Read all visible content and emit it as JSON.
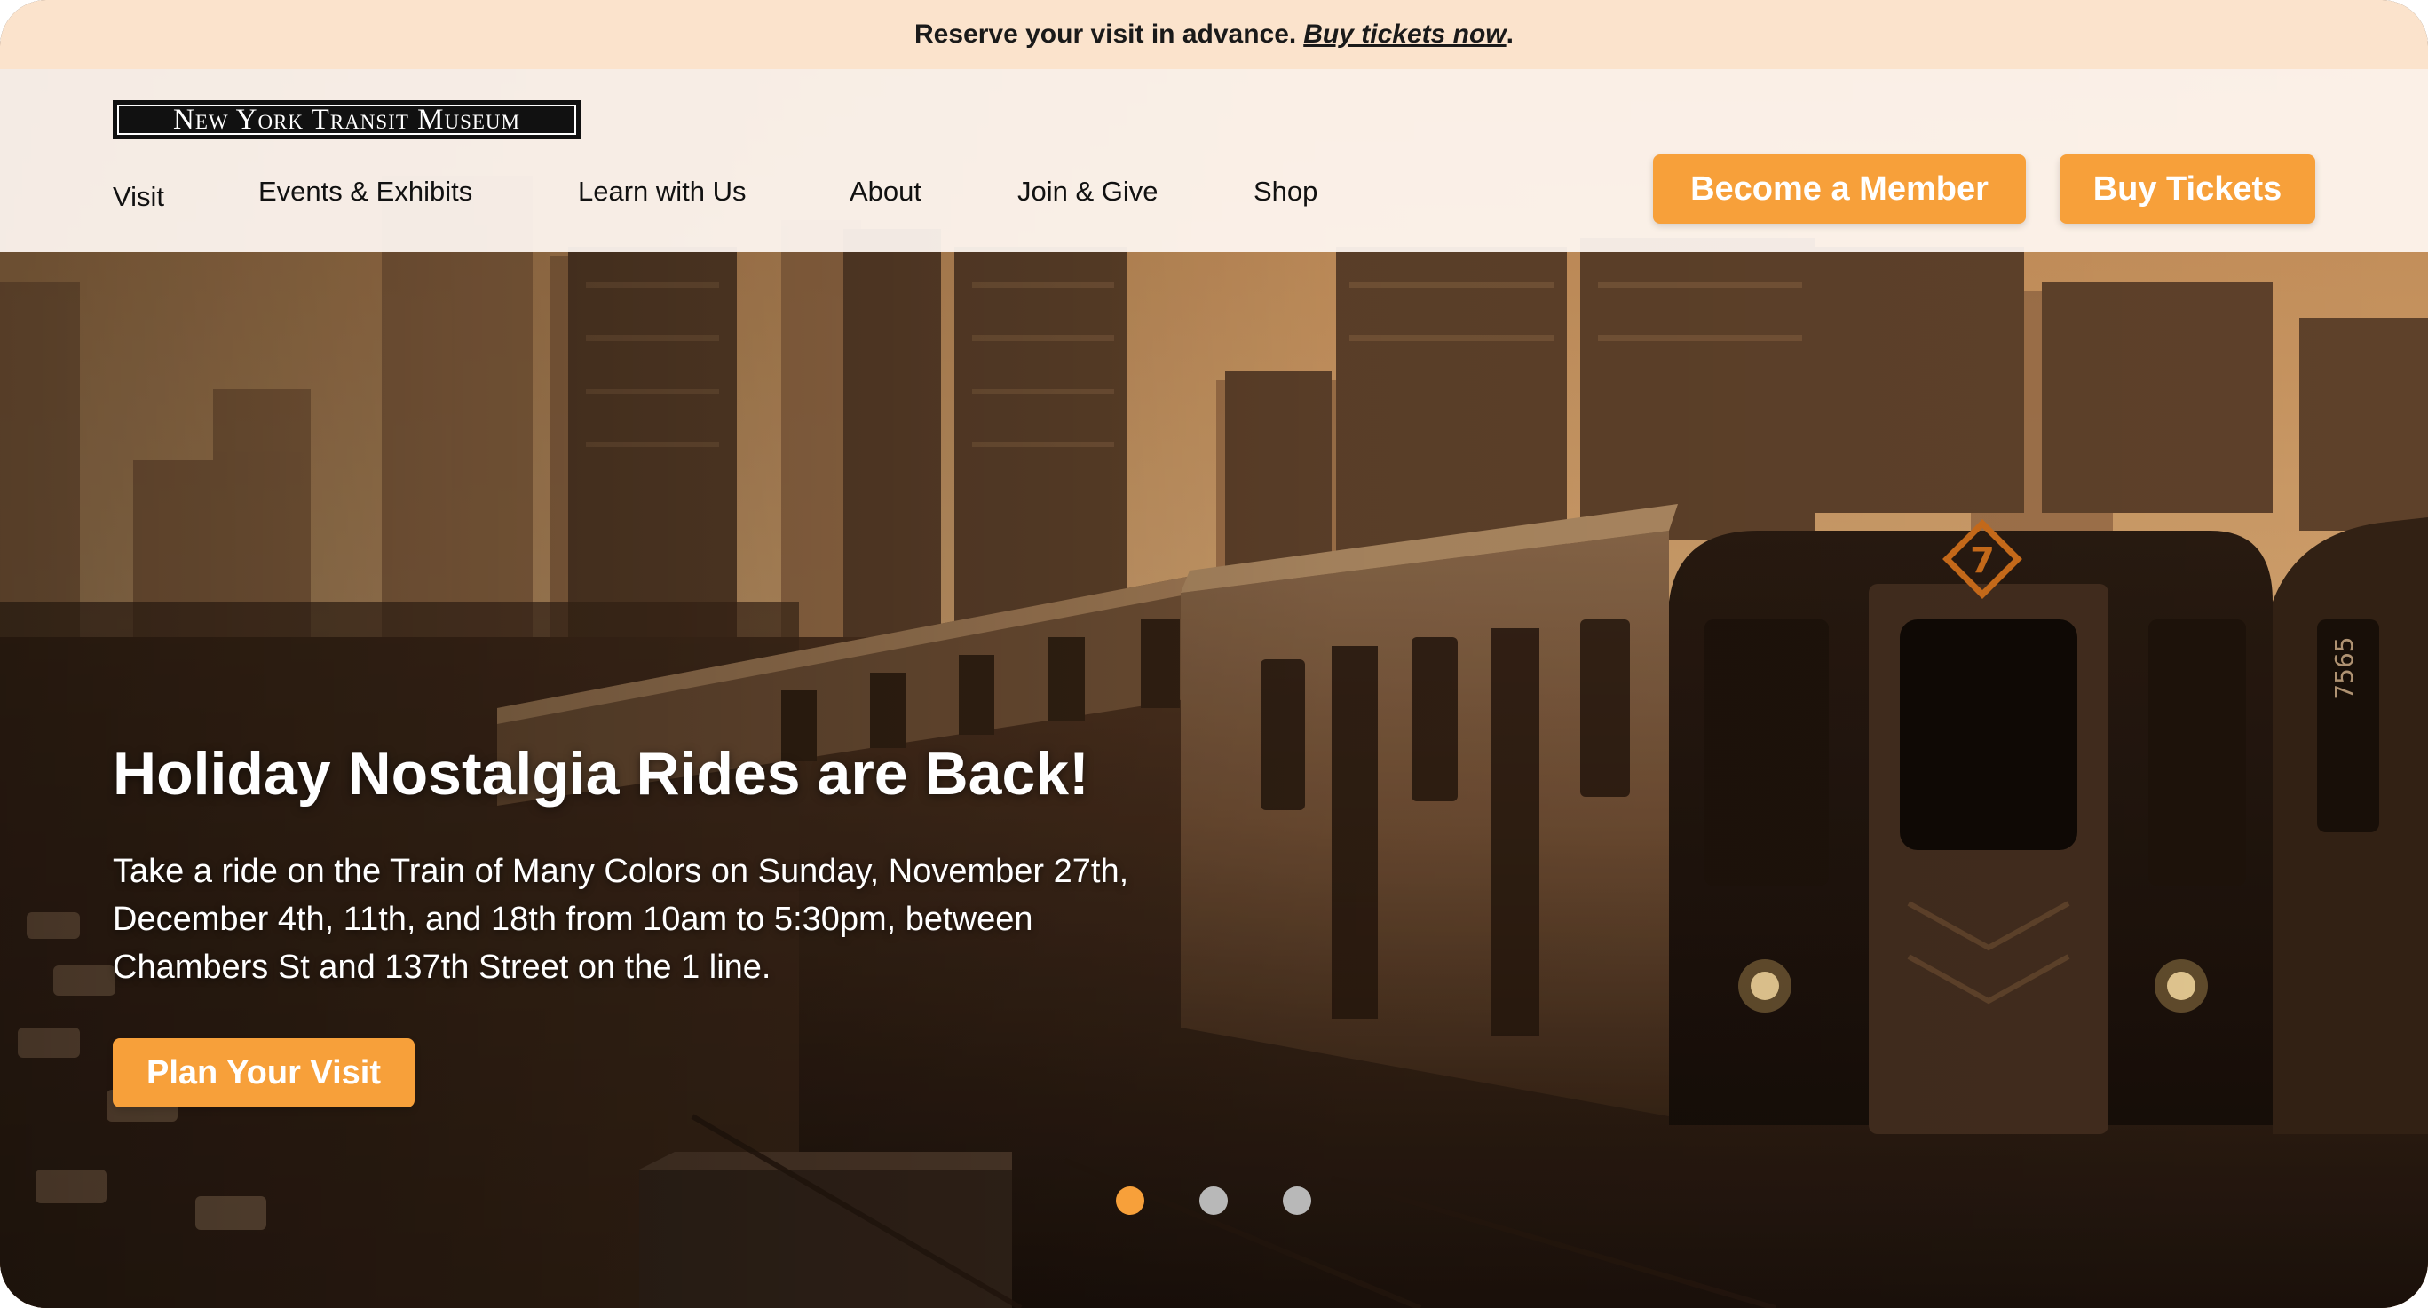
{
  "announcement": {
    "text": "Reserve your visit in advance.",
    "link": "Buy tickets now",
    "suffix": "."
  },
  "header": {
    "logo_text": "New York Transit Museum",
    "nav": [
      "Visit",
      "Events & Exhibits",
      "Learn with Us",
      "About",
      "Join & Give",
      "Shop"
    ],
    "member_button": "Become a Member",
    "tickets_button": "Buy Tickets"
  },
  "hero": {
    "headline": "Holiday Nostalgia Rides are Back!",
    "body": "Take a ride on the Train of Many Colors on Sunday, November 27th, December 4th, 11th, and 18th from 10am to 5:30pm, between Chambers St and 137th Street on the 1 line.",
    "cta": "Plan Your Visit",
    "train_route_badge": "7",
    "car_numbers": [
      "7565"
    ],
    "slides": 3,
    "active_slide": 0
  },
  "colors": {
    "accent": "#f7a03a",
    "announce_bg": "#fbe3cc",
    "header_bg": "#fff8f2"
  },
  "icons": [
    "route-7-badge-icon",
    "carousel-dot-icon"
  ]
}
